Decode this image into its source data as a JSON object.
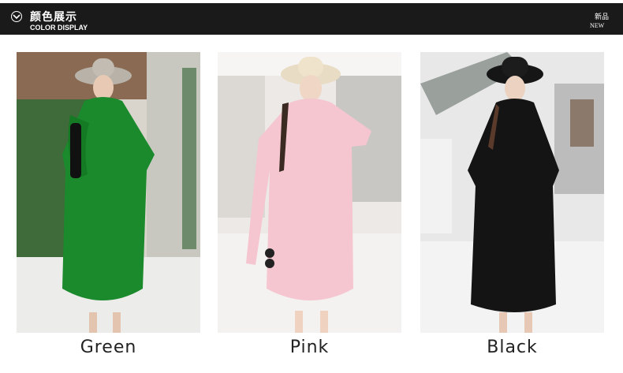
{
  "header": {
    "title_cn": "颜色展示",
    "title_en": "COLOR DISPLAY",
    "badge_cn": "新品",
    "badge_en": "NEW",
    "icon": "chevron-down-circle-icon"
  },
  "products": [
    {
      "label": "Green",
      "coat_color": "#1a8a2c"
    },
    {
      "label": "Pink",
      "coat_color": "#f5c6d0"
    },
    {
      "label": "Black",
      "coat_color": "#141414"
    }
  ],
  "colors": {
    "header_bg": "#1a1a1a",
    "header_text": "#ffffff",
    "label_text": "#222222"
  }
}
